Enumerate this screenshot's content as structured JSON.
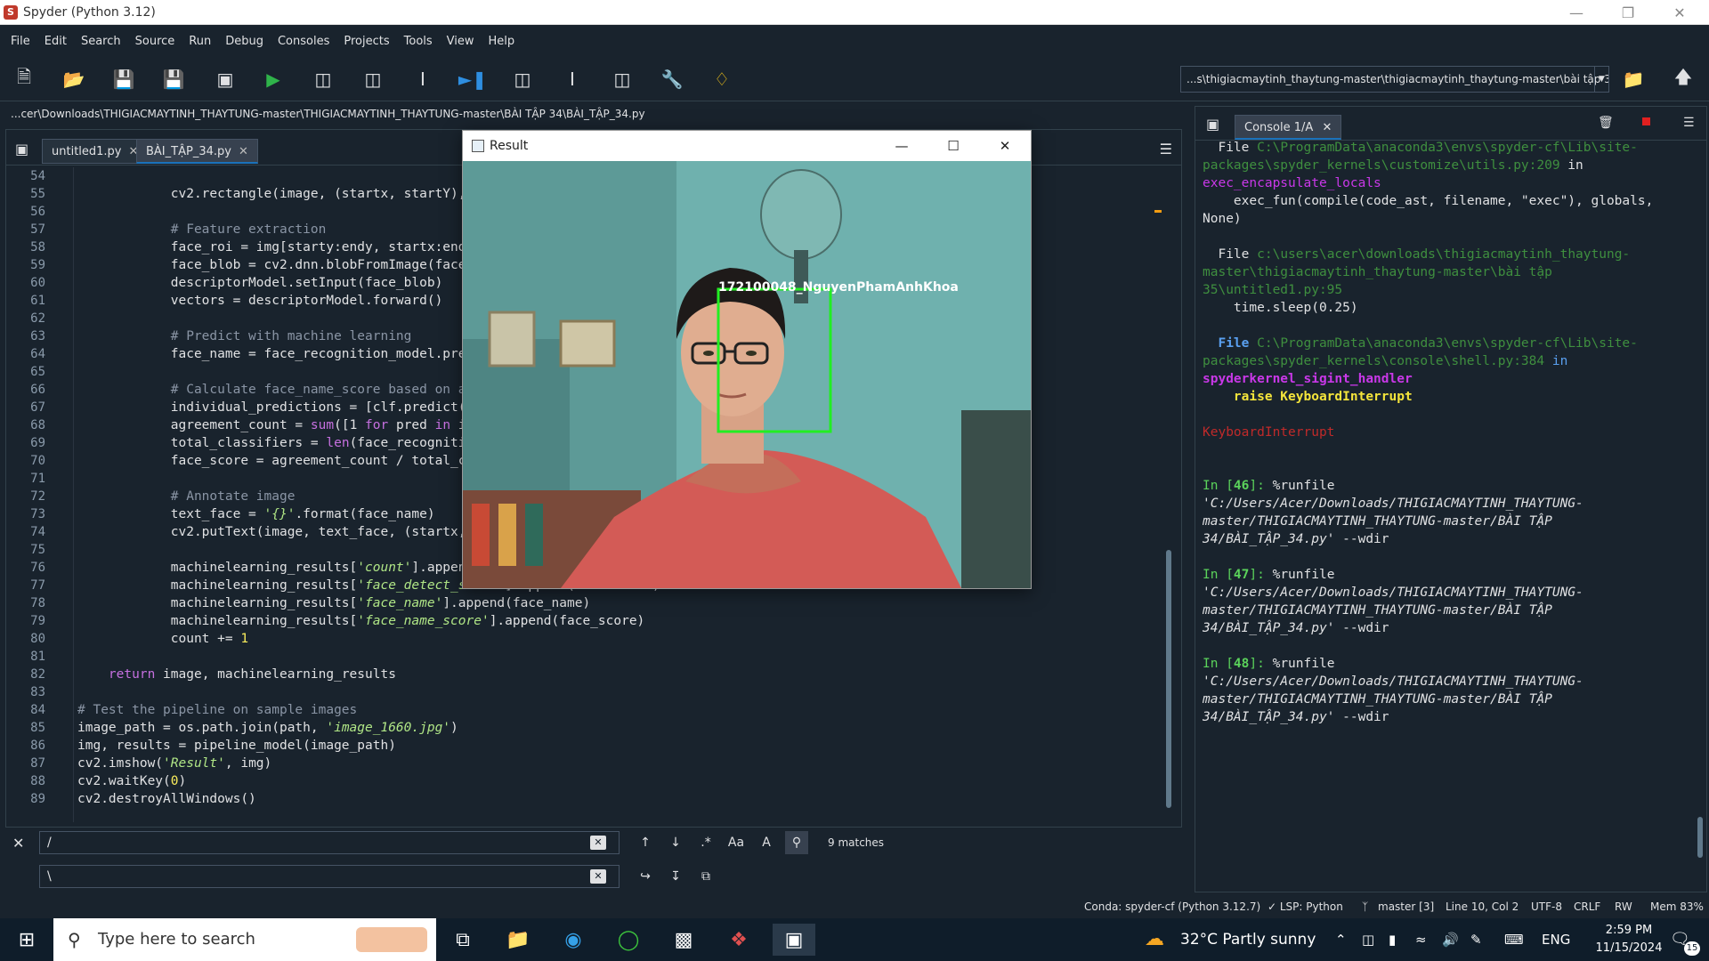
{
  "window": {
    "title": "Spyder (Python 3.12)"
  },
  "menu": [
    "File",
    "Edit",
    "Search",
    "Source",
    "Run",
    "Debug",
    "Consoles",
    "Projects",
    "Tools",
    "View",
    "Help"
  ],
  "toolbar": {
    "working_dir": "...s\\thigiacmaytinh_thaytung-master\\thigiacmaytinh_thaytung-master\\bài tập 34"
  },
  "editor": {
    "path": "...cer\\Downloads\\THIGIACMAYTINH_THAYTUNG-master\\THIGIACMAYTINH_THAYTUNG-master\\BÀI TẬP 34\\BÀI_TẬP_34.py",
    "tabs": [
      "untitled1.py",
      "BÀI_TẬP_34.py"
    ],
    "lines": [
      {
        "n": "54",
        "t": ""
      },
      {
        "n": "55",
        "t": "            cv2.rectangle(image, (startx, startY), (endX, endY), (0, 255, 0), 2)"
      },
      {
        "n": "56",
        "t": ""
      },
      {
        "n": "57",
        "t": "            # Feature extraction"
      },
      {
        "n": "58",
        "t": "            face_roi = img[starty:endy, startx:endx]"
      },
      {
        "n": "59",
        "t": "            face_blob = cv2.dnn.blobFromImage(face_roi, 1/255, (96, 96), (0, 0, 0), True, False)"
      },
      {
        "n": "60",
        "t": "            descriptorModel.setInput(face_blob)"
      },
      {
        "n": "61",
        "t": "            vectors = descriptorModel.forward()"
      },
      {
        "n": "62",
        "t": ""
      },
      {
        "n": "63",
        "t": "            # Predict with machine learning"
      },
      {
        "n": "64",
        "t": "            face_name = face_recognition_model.predict(vectors)[0]"
      },
      {
        "n": "65",
        "t": ""
      },
      {
        "n": "66",
        "t": "            # Calculate face_name_score based on agreement"
      },
      {
        "n": "67",
        "t": "            individual_predictions = [clf.predict(vectors)[0] for clf in face_recognition_model.estimators_]"
      },
      {
        "n": "68",
        "t": "            agreement_count = sum([1 for pred in individual_predictions if pred == face_name])"
      },
      {
        "n": "69",
        "t": "            total_classifiers = len(face_recognition_model.estimators_)"
      },
      {
        "n": "70",
        "t": "            face_score = agreement_count / total_classifiers"
      },
      {
        "n": "71",
        "t": ""
      },
      {
        "n": "72",
        "t": "            # Annotate image"
      },
      {
        "n": "73",
        "t": "            text_face = '{}'.format(face_name)"
      },
      {
        "n": "74",
        "t": "            cv2.putText(image, text_face, (startx, starty), cv2.FONT_HERSHEY_PLAIN, 2, (255, 255, 255), 2)"
      },
      {
        "n": "75",
        "t": ""
      },
      {
        "n": "76",
        "t": "            machinelearning_results['count'].append(count)"
      },
      {
        "n": "77",
        "t": "            machinelearning_results['face_detect_score'].append(confidence)"
      },
      {
        "n": "78",
        "t": "            machinelearning_results['face_name'].append(face_name)"
      },
      {
        "n": "79",
        "t": "            machinelearning_results['face_name_score'].append(face_score)"
      },
      {
        "n": "80",
        "t": "            count += 1"
      },
      {
        "n": "81",
        "t": ""
      },
      {
        "n": "82",
        "t": "    return image, machinelearning_results"
      },
      {
        "n": "83",
        "t": ""
      },
      {
        "n": "84",
        "t": "# Test the pipeline on sample images"
      },
      {
        "n": "85",
        "t": "image_path = os.path.join(path, 'image_1660.jpg')"
      },
      {
        "n": "86",
        "t": "img, results = pipeline_model(image_path)"
      },
      {
        "n": "87",
        "t": "cv2.imshow('Result', img)"
      },
      {
        "n": "88",
        "t": "cv2.waitKey(0)"
      },
      {
        "n": "89",
        "t": "cv2.destroyAllWindows()"
      }
    ]
  },
  "find": {
    "search_value": "/",
    "replace_value": "\\",
    "matches": "9 matches",
    "case_label": "Aa"
  },
  "popup": {
    "title": "Result",
    "face_label": "172100048_NguyenPhamAnhKhoa"
  },
  "console": {
    "tab": "Console 1/A",
    "tb1_file": "  File ",
    "tb1_path": "C:\\ProgramData\\anaconda3\\envs\\spyder-cf\\Lib\\site-packages\\spyder_kernels\\customize\\utils.py:209",
    "tb1_in": " in",
    "tb1_func": "exec_encapsulate_locals",
    "tb1_code": "    exec_fun(compile(code_ast, filename, \"exec\"), globals, None)",
    "tb2_file": "  File ",
    "tb2_path": "c:\\users\\acer\\downloads\\thigiacmaytinh_thaytung-master\\thigiacmaytinh_thaytung-master\\bài tập 35\\untitled1.py:95",
    "tb2_code": "    time.sleep(0.25)",
    "tb3_file": "  File ",
    "tb3_path": "C:\\ProgramData\\anaconda3\\envs\\spyder-cf\\Lib\\site-packages\\spyder_kernels\\console\\shell.py:384",
    "tb3_in": " in",
    "tb3_func": "spyderkernel_sigint_handler",
    "tb3_code": "    raise KeyboardInterrupt",
    "error": "KeyboardInterrupt",
    "prompts": [
      {
        "num": "46",
        "path": "'C:/Users/Acer/Downloads/THIGIACMAYTINH_THAYTUNG-master/THIGIACMAYTINH_THAYTUNG-master/BÀI TẬP 34/BÀI_TẬP_34.py'"
      },
      {
        "num": "47",
        "path": "'C:/Users/Acer/Downloads/THIGIACMAYTINH_THAYTUNG-master/THIGIACMAYTINH_THAYTUNG-master/BÀI TẬP 34/BÀI_TẬP_34.py'"
      },
      {
        "num": "48",
        "path": "'C:/Users/Acer/Downloads/THIGIACMAYTINH_THAYTUNG-master/THIGIACMAYTINH_THAYTUNG-master/BÀI TẬP 34/BÀI_TẬP_34.py'"
      }
    ],
    "cmd": "%runfile",
    "wdir": " --wdir"
  },
  "status": {
    "conda": "Conda: spyder-cf (Python 3.12.7)",
    "lsp": "✓ LSP: Python",
    "git": "master [3]",
    "position": "Line 10, Col 2",
    "encoding": "UTF-8",
    "eol": "CRLF",
    "rw": "RW",
    "mem": "Mem 83%"
  },
  "taskbar": {
    "search_placeholder": "Type here to search",
    "weather": "32°C  Partly sunny",
    "lang": "ENG",
    "time": "2:59 PM",
    "date": "11/15/2024",
    "notif_count": "15"
  }
}
